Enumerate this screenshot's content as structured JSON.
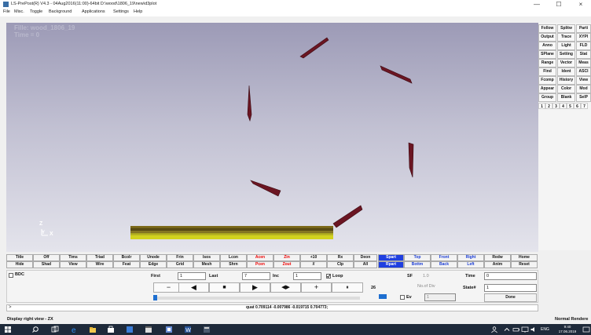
{
  "window": {
    "title": "LS-PrePost(R) V4.3 - 04Aug2016(11:00)-64bit D:\\wood\\1806_19\\new\\d3plot",
    "minimize": "—",
    "maximize": "☐",
    "close": "×"
  },
  "menu": [
    "File",
    "Misc.",
    "Toggle",
    "Background",
    "Applications",
    "Settings",
    "Help"
  ],
  "viewport": {
    "line1": "Fille: wood_1806_19",
    "line2": "Time =      0",
    "axis_z": "Z",
    "axis_y": "Y",
    "axis_x": "X",
    "colors": {
      "blade": "#6b1522",
      "blade_edge": "#3a0b12",
      "slab_top": "#7d6a1a",
      "slab_mid": "#5a4c12",
      "slab_bottom": "#d2d21e"
    }
  },
  "right_panel": {
    "rows": [
      [
        "Follow",
        "Splitw",
        "Parti"
      ],
      [
        "Output",
        "Trace",
        "XYPl"
      ],
      [
        "Anno",
        "Light",
        "FLD"
      ],
      [
        "SPlane",
        "Setting",
        "Stat"
      ],
      [
        "Range",
        "Vector",
        "Meas"
      ],
      [
        "Find",
        "Ident",
        "ASCI"
      ],
      [
        "Fcomp",
        "History",
        "View"
      ],
      [
        "Appear",
        "Color",
        "Mod"
      ],
      [
        "Group",
        "Blank",
        "SelP"
      ]
    ],
    "tabs": [
      "1",
      "2",
      "3",
      "4",
      "5",
      "6",
      "7"
    ]
  },
  "toolbar": {
    "row1": [
      "Title",
      "Off",
      "Tims",
      "Triad",
      "Bcolr",
      "Unode",
      "Frin",
      "Isos",
      "Lcon",
      "Acen",
      "Zin",
      "+10",
      "Rx",
      "Deon",
      "Spart",
      "Top",
      "Front",
      "Right",
      "Redw",
      "Home"
    ],
    "row2": [
      "Hide",
      "Shad",
      "View",
      "Wire",
      "Feat",
      "Edge",
      "Grid",
      "Mesh",
      "Shrn",
      "Pcen",
      "Zout",
      "//",
      "Clp",
      "All",
      "Rpart",
      "Bottm",
      "Back",
      "Left",
      "Anim",
      "Reset"
    ]
  },
  "animation": {
    "bdc_label": "BDC",
    "first_label": "First",
    "first_value": "1",
    "last_label": "Last",
    "last_value": "7",
    "inc_label": "Inc",
    "inc_value": "1",
    "loop_label": "Loop",
    "loop_checked": true,
    "sf_label": "SF",
    "sf_value": "1.0",
    "time_label": "Time",
    "time_value": "0",
    "divs_label": "No.of Div",
    "state_label": "State#",
    "state_value": "1",
    "speed_value": "26",
    "ev_label": "Ev",
    "ev_value": "1",
    "done_label": "Done",
    "buttons": {
      "minus": "−",
      "step_back": "◀",
      "stop": "■",
      "play": "▶",
      "bounce": "◀▶",
      "plus": "+",
      "pause": "⏸"
    },
    "slider_fraction": 0.0
  },
  "command": {
    "prompt": ">",
    "output": "quat 0.709114 -0.007986 -0.019715 0.704773;"
  },
  "status": {
    "left": "Display right view - ZX",
    "right": "Normal Rendere"
  },
  "taskbar": {
    "lang": "ENG",
    "time": "9:40",
    "date": "17.06.2019"
  }
}
